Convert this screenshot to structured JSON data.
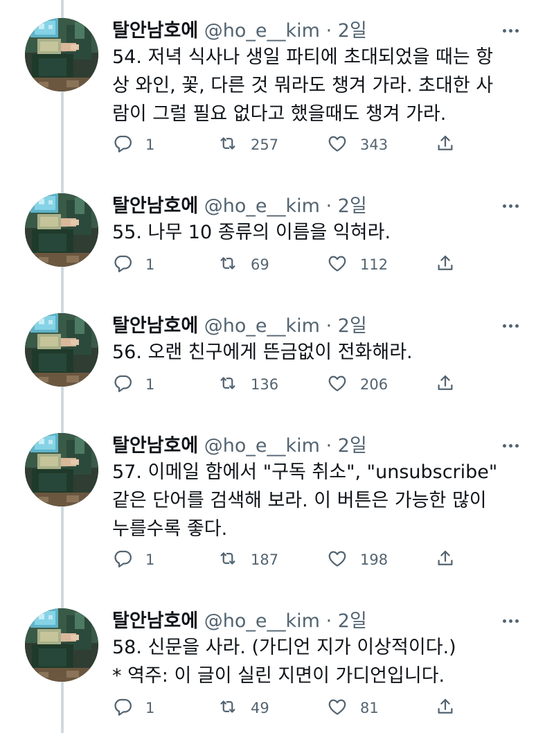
{
  "tweets": [
    {
      "name": "탈안남호에",
      "handle": "@ho_e__kim",
      "dot": "·",
      "time": "2일",
      "lines": [
        "54. 저녁 식사나 생일 파티에 초대되었을 때는 항",
        "상 와인, 꽃, 다른 것 뭐라도 챙겨 가라. 초대한 사",
        "람이 그럴 필요 없다고 했을때도 챙겨 가라."
      ],
      "replies": "1",
      "retweets": "257",
      "likes": "343"
    },
    {
      "name": "탈안남호에",
      "handle": "@ho_e__kim",
      "dot": "·",
      "time": "2일",
      "lines": [
        "55. 나무 10 종류의 이름을 익혀라."
      ],
      "replies": "1",
      "retweets": "69",
      "likes": "112"
    },
    {
      "name": "탈안남호에",
      "handle": "@ho_e__kim",
      "dot": "·",
      "time": "2일",
      "lines": [
        "56. 오랜 친구에게 뜬금없이 전화해라."
      ],
      "replies": "1",
      "retweets": "136",
      "likes": "206"
    },
    {
      "name": "탈안남호에",
      "handle": "@ho_e__kim",
      "dot": "·",
      "time": "2일",
      "lines": [
        "57. 이메일 함에서 \"구독 취소\", \"unsubscribe\"",
        "같은 단어를 검색해 보라. 이 버튼은 가능한 많이",
        "누를수록 좋다."
      ],
      "replies": "1",
      "retweets": "187",
      "likes": "198"
    },
    {
      "name": "탈안남호에",
      "handle": "@ho_e__kim",
      "dot": "·",
      "time": "2일",
      "lines": [
        "58. 신문을 사라. (가디언 지가 이상적이다.)",
        "* 역주: 이 글이 실린 지면이 가디언입니다."
      ],
      "replies": "1",
      "retweets": "49",
      "likes": "81"
    }
  ],
  "icons": {
    "reply": "reply-icon",
    "retweet": "retweet-icon",
    "like": "heart-icon",
    "share": "share-icon",
    "more": "more-icon"
  },
  "colors": {
    "text": "#0f1419",
    "secondary": "#536471",
    "thread_line": "#cfd9de"
  }
}
